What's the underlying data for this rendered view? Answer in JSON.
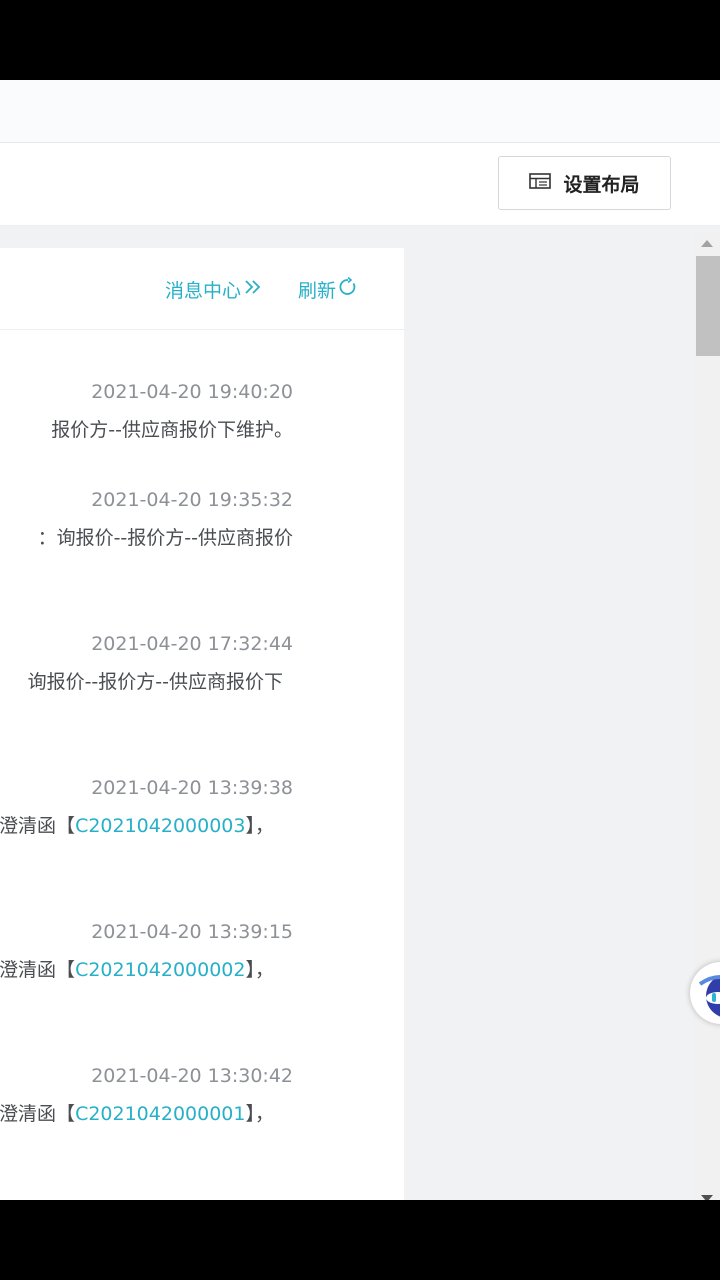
{
  "toolbar": {
    "layout_label": "设置布局"
  },
  "panel": {
    "message_center_label": "消息中心",
    "refresh_label": "刷新"
  },
  "messages": [
    {
      "time": "2021-04-20 19:40:20",
      "text": "报价方--供应商报价下维护。",
      "code": "",
      "suffix": ""
    },
    {
      "time": "2021-04-20 19:35:32",
      "text": "：询报价--报价方--供应商报价",
      "code": "",
      "suffix": ""
    },
    {
      "time": "2021-04-20 17:32:44",
      "text": "询报价--报价方--供应商报价下",
      "code": "",
      "suffix": ""
    },
    {
      "time": "2021-04-20 13:39:38",
      "text": "澄清函【",
      "code": "C2021042000003",
      "suffix": "】，"
    },
    {
      "time": "2021-04-20 13:39:15",
      "text": "澄清函【",
      "code": "C2021042000002",
      "suffix": "】，"
    },
    {
      "time": "2021-04-20 13:30:42",
      "text": "澄清函【",
      "code": "C2021042000001",
      "suffix": "】，"
    }
  ],
  "colors": {
    "accent": "#27b0c8",
    "time": "#8d9096",
    "text": "#4a4d52"
  }
}
